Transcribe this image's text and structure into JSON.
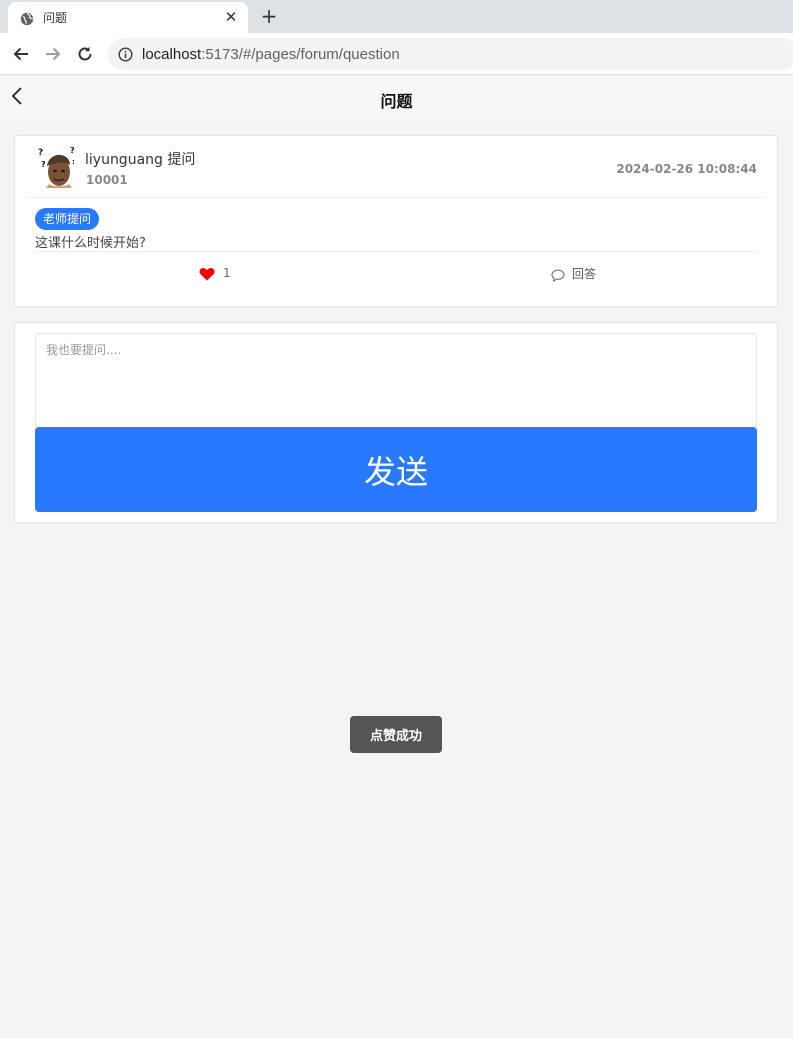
{
  "browser": {
    "tab_title": "问题",
    "tab_close": "✕",
    "new_tab": "+",
    "url_host": "localhost",
    "url_rest": ":5173/#/pages/forum/question"
  },
  "header": {
    "title": "问题"
  },
  "question": {
    "author": "liyunguang 提问",
    "user_id": "10001",
    "time": "2024-02-26 10:08:44",
    "badge": "老师提问",
    "text": "这课什么时候开始?",
    "likes": "1",
    "answer_label": "回答"
  },
  "form": {
    "placeholder": "我也要提问....",
    "send_label": "发送"
  },
  "toast": {
    "text": "点赞成功"
  },
  "colors": {
    "accent": "#2979ff",
    "like": "#ff0000",
    "toast_bg": "#555555"
  },
  "icons": [
    "globe-icon",
    "close-icon",
    "plus-icon",
    "back-arrow-icon",
    "forward-arrow-icon",
    "reload-icon",
    "info-icon",
    "chevron-left-icon",
    "heart-icon",
    "comment-icon"
  ]
}
